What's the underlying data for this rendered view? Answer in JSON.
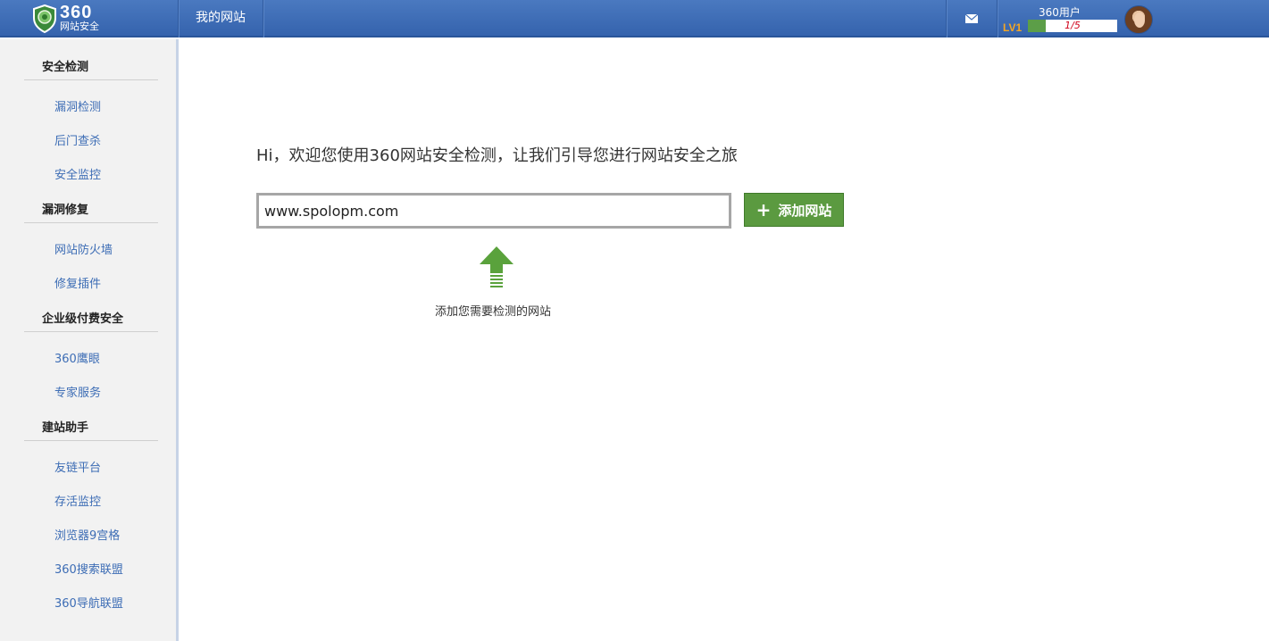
{
  "header": {
    "brand_number": "360",
    "brand_sub": "网站安全",
    "nav_my_sites": "我的网站",
    "user_name": "360用户",
    "level": "LV1",
    "level_progress_text": "1/5",
    "level_progress_fraction": 0.2
  },
  "sidebar": {
    "sections": [
      {
        "title": "安全检测",
        "items": [
          "漏洞检测",
          "后门查杀",
          "安全监控"
        ]
      },
      {
        "title": "漏洞修复",
        "items": [
          "网站防火墙",
          "修复插件"
        ]
      },
      {
        "title": "企业级付费安全",
        "items": [
          "360鹰眼",
          "专家服务"
        ]
      },
      {
        "title": "建站助手",
        "items": [
          "友链平台",
          "存活监控",
          "浏览器9宫格",
          "360搜索联盟",
          "360导航联盟"
        ]
      }
    ]
  },
  "main": {
    "welcome": "Hi，欢迎您使用360网站安全检测，让我们引导您进行网站安全之旅",
    "site_input_value": "www.spolopm.com",
    "add_button_label": "添加网站",
    "hint": "添加您需要检测的网站"
  },
  "colors": {
    "header_blue": "#3f6fb8",
    "button_green": "#5b9a40",
    "arrow_green": "#5aa23c",
    "link_blue": "#3d6db5",
    "level_orange": "#f5a623"
  }
}
